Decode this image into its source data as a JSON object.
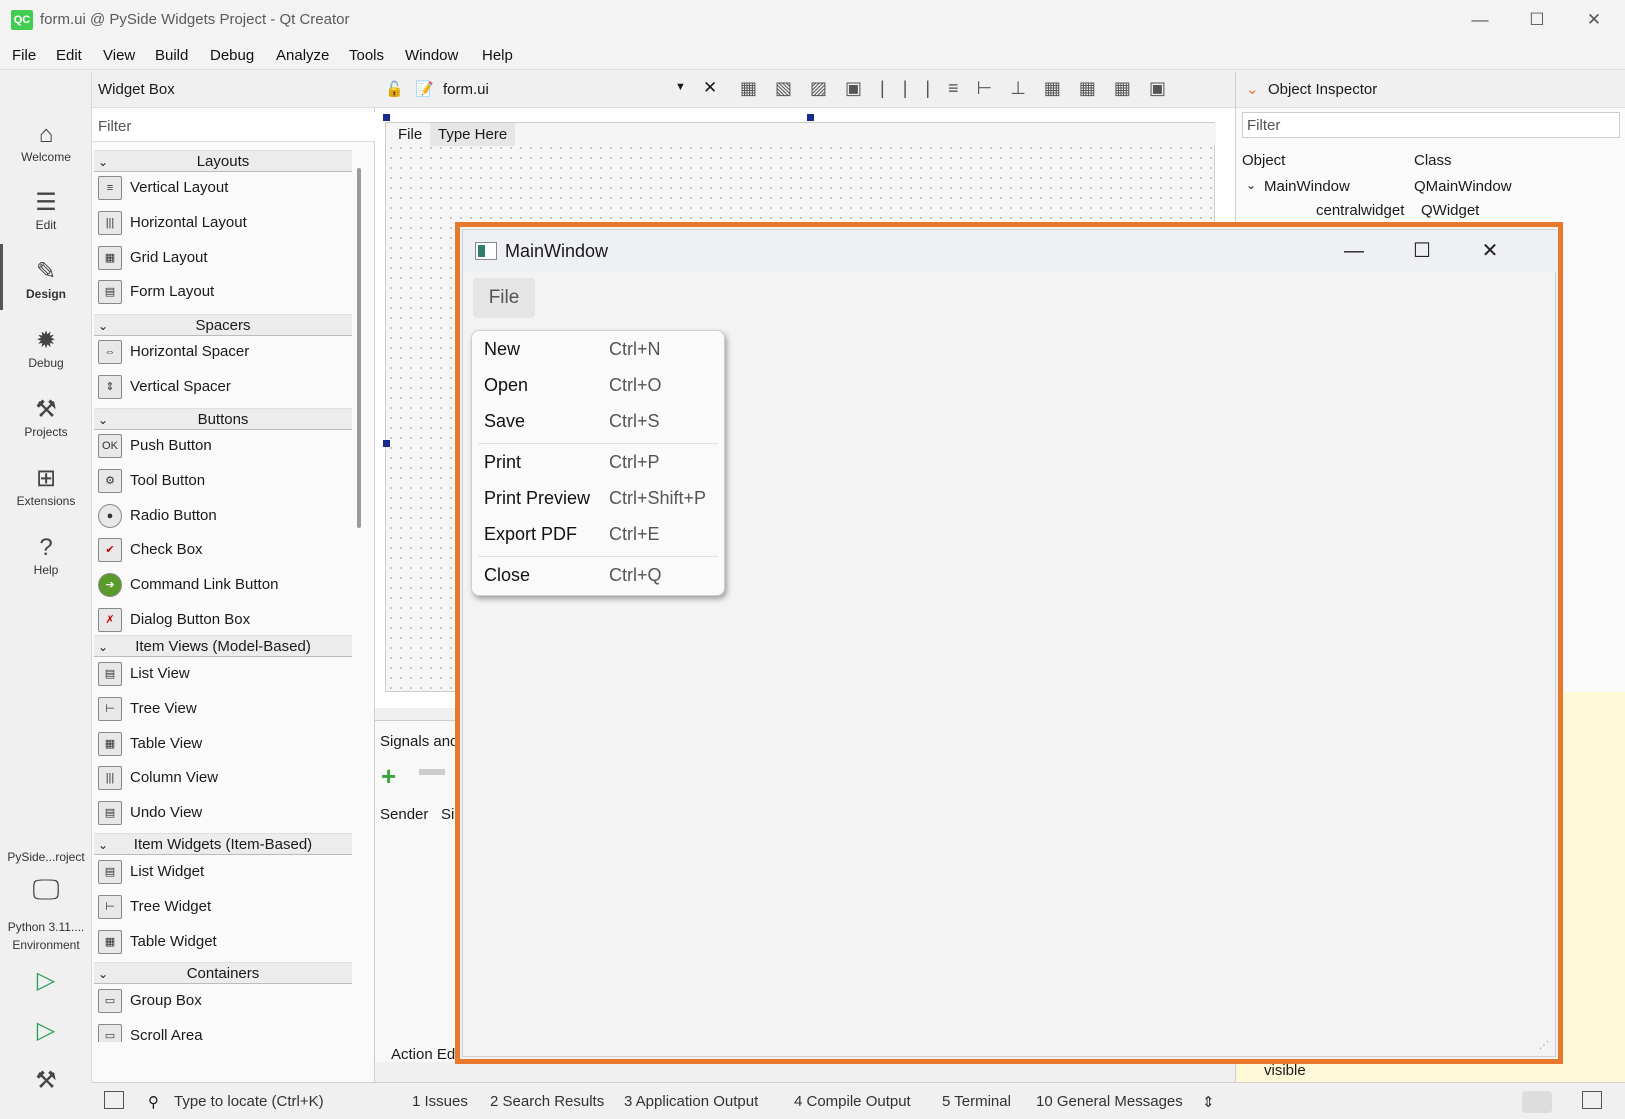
{
  "window": {
    "title": "form.ui @ PySide Widgets Project - Qt Creator",
    "logo": "QC",
    "controls": {
      "minimize": "—",
      "maximize": "☐",
      "close": "✕"
    }
  },
  "menubar": [
    "File",
    "Edit",
    "View",
    "Build",
    "Debug",
    "Analyze",
    "Tools",
    "Window",
    "Help"
  ],
  "modes": [
    {
      "label": "Welcome",
      "icon": "home-icon"
    },
    {
      "label": "Edit",
      "icon": "edit-icon"
    },
    {
      "label": "Design",
      "icon": "design-icon"
    },
    {
      "label": "Debug",
      "icon": "bug-icon"
    },
    {
      "label": "Projects",
      "icon": "wrench-icon"
    },
    {
      "label": "Extensions",
      "icon": "extensions-icon"
    },
    {
      "label": "Help",
      "icon": "help-icon"
    }
  ],
  "kit": {
    "project": "PySide...roject",
    "env1": "Python 3.11....",
    "env2": "Environment"
  },
  "widget_box": {
    "title": "Widget Box",
    "filter_placeholder": "Filter",
    "categories": [
      {
        "name": "Layouts",
        "items": [
          "Vertical Layout",
          "Horizontal Layout",
          "Grid Layout",
          "Form Layout"
        ]
      },
      {
        "name": "Spacers",
        "items": [
          "Horizontal Spacer",
          "Vertical Spacer"
        ]
      },
      {
        "name": "Buttons",
        "items": [
          "Push Button",
          "Tool Button",
          "Radio Button",
          "Check Box",
          "Command Link Button",
          "Dialog Button Box"
        ]
      },
      {
        "name": "Item Views (Model-Based)",
        "items": [
          "List View",
          "Tree View",
          "Table View",
          "Column View",
          "Undo View"
        ]
      },
      {
        "name": "Item Widgets (Item-Based)",
        "items": [
          "List Widget",
          "Tree Widget",
          "Table Widget"
        ]
      },
      {
        "name": "Containers",
        "items": [
          "Group Box",
          "Scroll Area"
        ]
      }
    ]
  },
  "editor": {
    "file": "form.ui",
    "form_menu": [
      "File",
      "Type Here"
    ],
    "signals_title": "Signals and",
    "sender_col": "Sender",
    "sig_col": "Si",
    "action_tab": "Action Ed"
  },
  "object_inspector": {
    "title": "Object Inspector",
    "filter_placeholder": "Filter",
    "columns": [
      "Object",
      "Class"
    ],
    "rows": [
      {
        "object": "MainWindow",
        "class": "QMainWindow"
      },
      {
        "object": "centralwidget",
        "class": "QWidget"
      }
    ],
    "property": "visible"
  },
  "statusbar": {
    "locate_placeholder": "Type to locate (Ctrl+K)",
    "panes": [
      "1  Issues",
      "2  Search Results",
      "3  Application Output",
      "4  Compile Output",
      "5  Terminal",
      "10  General Messages"
    ]
  },
  "preview": {
    "title": "MainWindow",
    "menu": "File",
    "items": [
      {
        "label": "New",
        "shortcut": "Ctrl+N"
      },
      {
        "label": "Open",
        "shortcut": "Ctrl+O"
      },
      {
        "label": "Save",
        "shortcut": "Ctrl+S"
      },
      {
        "label": "Print",
        "shortcut": "Ctrl+P"
      },
      {
        "label": "Print Preview",
        "shortcut": "Ctrl+Shift+P"
      },
      {
        "label": "Export PDF",
        "shortcut": "Ctrl+E"
      },
      {
        "label": "Close",
        "shortcut": "Ctrl+Q"
      }
    ],
    "highlight_color": "#e8792c"
  }
}
